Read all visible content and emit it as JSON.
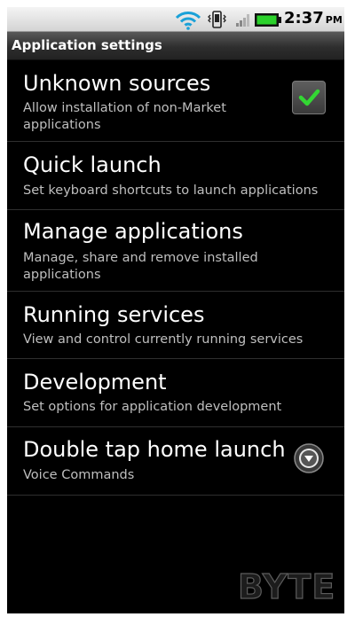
{
  "status_bar": {
    "time": "2:37",
    "ampm": "PM",
    "icons": [
      "wifi-icon",
      "vibrate-icon",
      "signal-icon",
      "battery-icon"
    ],
    "battery_color": "#2bd12b"
  },
  "title_bar": {
    "title": "Application settings"
  },
  "settings": [
    {
      "title": "Unknown sources",
      "summary": "Allow installation of non-Market applications",
      "control": "checkbox",
      "checked": true
    },
    {
      "title": "Quick launch",
      "summary": "Set keyboard shortcuts to launch applications"
    },
    {
      "title": "Manage applications",
      "summary": "Manage, share and remove installed applications"
    },
    {
      "title": "Running services",
      "summary": "View and control currently running services"
    },
    {
      "title": "Development",
      "summary": "Set options for application development"
    },
    {
      "title": "Double tap home launch",
      "summary": "Voice Commands",
      "control": "dropdown"
    }
  ],
  "colors": {
    "accent_check": "#33d633",
    "background": "#000000"
  },
  "watermark": "BYTE"
}
